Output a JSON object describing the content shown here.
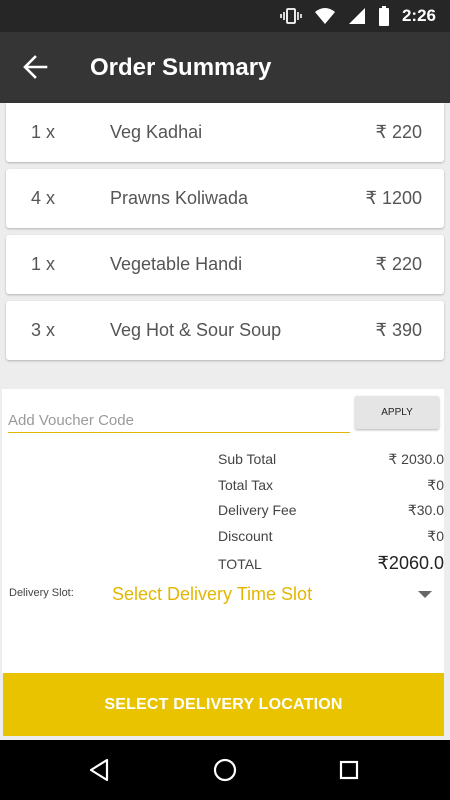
{
  "status_bar": {
    "time": "2:26"
  },
  "app_bar": {
    "title": "Order Summary"
  },
  "order_items": [
    {
      "qty": "1 x",
      "name": "Veg Kadhai",
      "price": "₹ 220"
    },
    {
      "qty": "4 x",
      "name": "Prawns Koliwada",
      "price": "₹ 1200"
    },
    {
      "qty": "1 x",
      "name": "Vegetable Handi",
      "price": "₹ 220"
    },
    {
      "qty": "3 x",
      "name": "Veg Hot & Sour Soup",
      "price": "₹ 390"
    }
  ],
  "voucher": {
    "placeholder": "Add Voucher Code",
    "apply_label": "APPLY"
  },
  "totals": {
    "sub_total_label": "Sub Total",
    "sub_total_value": "₹ 2030.0",
    "tax_label": "Total Tax",
    "tax_value": "₹0",
    "delivery_label": "Delivery Fee",
    "delivery_value": "₹30.0",
    "discount_label": "Discount",
    "discount_value": "₹0",
    "total_label": "TOTAL",
    "total_value": "₹2060.0"
  },
  "delivery_slot": {
    "label": "Delivery Slot:",
    "selected": "Select Delivery Time Slot"
  },
  "cta": {
    "label": "SELECT DELIVERY LOCATION"
  },
  "colors": {
    "accent": "#e9c300",
    "app_bar": "#353535",
    "status_bar": "#262626"
  }
}
